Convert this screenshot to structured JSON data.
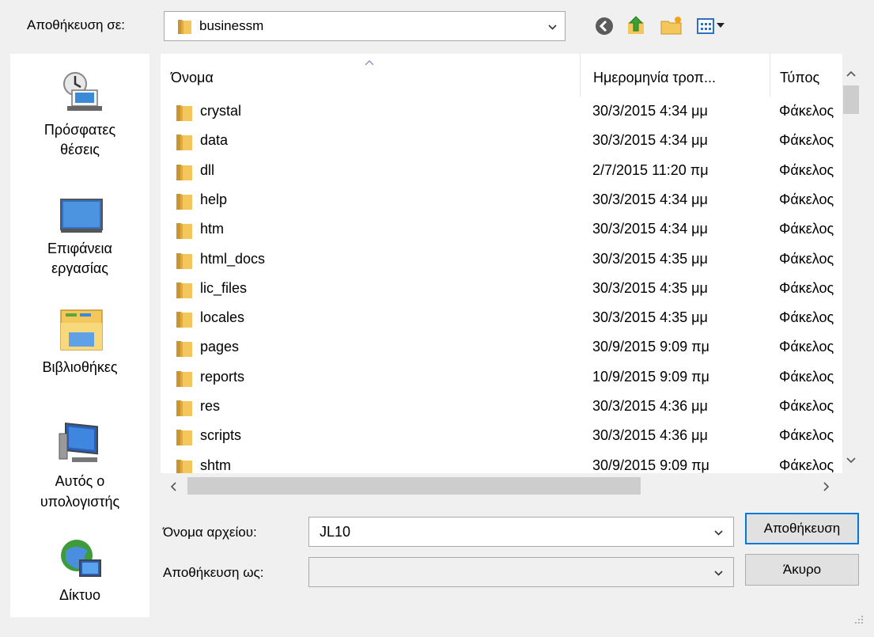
{
  "top": {
    "save_in_label": "Αποθήκευση σε:",
    "save_in_value": "businessm"
  },
  "places": [
    {
      "label_line1": "Πρόσφατες",
      "label_line2": "θέσεις",
      "icon": "recent-places-icon"
    },
    {
      "label_line1": "Επιφάνεια",
      "label_line2": "εργασίας",
      "icon": "desktop-icon"
    },
    {
      "label_line1": "Βιβλιοθήκες",
      "label_line2": "",
      "icon": "libraries-icon"
    },
    {
      "label_line1": "Αυτός ο",
      "label_line2": "υπολογιστής",
      "icon": "computer-icon"
    },
    {
      "label_line1": "Δίκτυο",
      "label_line2": "",
      "icon": "network-icon"
    }
  ],
  "columns": {
    "name": "Όνομα",
    "date": "Ημερομηνία τροπ...",
    "type": "Τύπος"
  },
  "files": [
    {
      "name": "crystal",
      "date": "30/3/2015 4:34 μμ",
      "type": "Φάκελος"
    },
    {
      "name": "data",
      "date": "30/3/2015 4:34 μμ",
      "type": "Φάκελος"
    },
    {
      "name": "dll",
      "date": "2/7/2015 11:20 πμ",
      "type": "Φάκελος"
    },
    {
      "name": "help",
      "date": "30/3/2015 4:34 μμ",
      "type": "Φάκελος"
    },
    {
      "name": "htm",
      "date": "30/3/2015 4:34 μμ",
      "type": "Φάκελος"
    },
    {
      "name": "html_docs",
      "date": "30/3/2015 4:35 μμ",
      "type": "Φάκελος"
    },
    {
      "name": "lic_files",
      "date": "30/3/2015 4:35 μμ",
      "type": "Φάκελος"
    },
    {
      "name": "locales",
      "date": "30/3/2015 4:35 μμ",
      "type": "Φάκελος"
    },
    {
      "name": "pages",
      "date": "30/9/2015 9:09 πμ",
      "type": "Φάκελος"
    },
    {
      "name": "reports",
      "date": "10/9/2015 9:09 πμ",
      "type": "Φάκελος"
    },
    {
      "name": "res",
      "date": "30/3/2015 4:36 μμ",
      "type": "Φάκελος"
    },
    {
      "name": "scripts",
      "date": "30/3/2015 4:36 μμ",
      "type": "Φάκελος"
    },
    {
      "name": "shtm",
      "date": "30/9/2015 9:09 πμ",
      "type": "Φάκελος"
    }
  ],
  "bottom": {
    "filename_label": "Όνομα αρχείου:",
    "filename_value": "JL10",
    "savetype_label": "Αποθήκευση ως:",
    "savetype_value": "",
    "save_button": "Αποθήκευση",
    "cancel_button": "Άκυρο"
  },
  "colors": {
    "accent": "#0078d7",
    "folder": "#e8b84a"
  }
}
